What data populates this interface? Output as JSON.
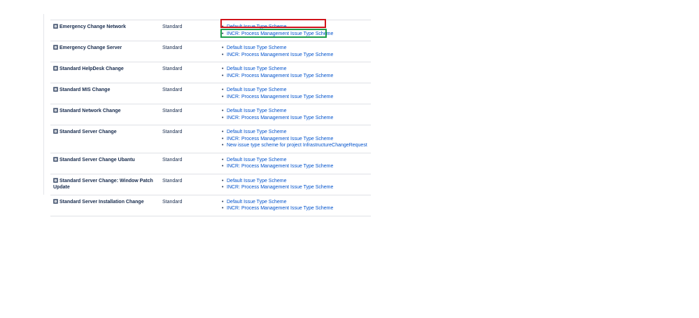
{
  "colors": {
    "link": "#0052cc",
    "text": "#172b4d",
    "highlight_red": "#d0131a",
    "highlight_green": "#1e9e4a",
    "row_divider": "#dfe1e6"
  },
  "icons": {
    "issue_type": "issue-type-icon"
  },
  "rows": [
    {
      "name": "Emergency Change Network",
      "type": "Standard",
      "schemes": [
        "Default Issue Type Scheme",
        "INCR: Process Management Issue Type Scheme"
      ]
    },
    {
      "name": "Emergency Change Server",
      "type": "Standard",
      "schemes": [
        "Default Issue Type Scheme",
        "INCR: Process Management Issue Type Scheme"
      ]
    },
    {
      "name": "Standard HelpDesk Change",
      "type": "Standard",
      "schemes": [
        "Default Issue Type Scheme",
        "INCR: Process Management Issue Type Scheme"
      ]
    },
    {
      "name": "Standard MIS Change",
      "type": "Standard",
      "schemes": [
        "Default Issue Type Scheme",
        "INCR: Process Management Issue Type Scheme"
      ]
    },
    {
      "name": "Standard Network Change",
      "type": "Standard",
      "schemes": [
        "Default Issue Type Scheme",
        "INCR: Process Management Issue Type Scheme"
      ]
    },
    {
      "name": "Standard Server Change",
      "type": "Standard",
      "schemes": [
        "Default Issue Type Scheme",
        "INCR: Process Management Issue Type Scheme",
        "New issue type scheme for project InfrastructureChangeRequest"
      ]
    },
    {
      "name": "Standard Server Change Ubantu",
      "type": "Standard",
      "schemes": [
        "Default Issue Type Scheme",
        "INCR: Process Management Issue Type Scheme"
      ]
    },
    {
      "name": "Standard Server Change: Window Patch Update",
      "type": "Standard",
      "schemes": [
        "Default Issue Type Scheme",
        "INCR: Process Management Issue Type Scheme"
      ]
    },
    {
      "name": "Standard Server Installation Change",
      "type": "Standard",
      "schemes": [
        "Default Issue Type Scheme",
        "INCR: Process Management Issue Type Scheme"
      ]
    }
  ]
}
